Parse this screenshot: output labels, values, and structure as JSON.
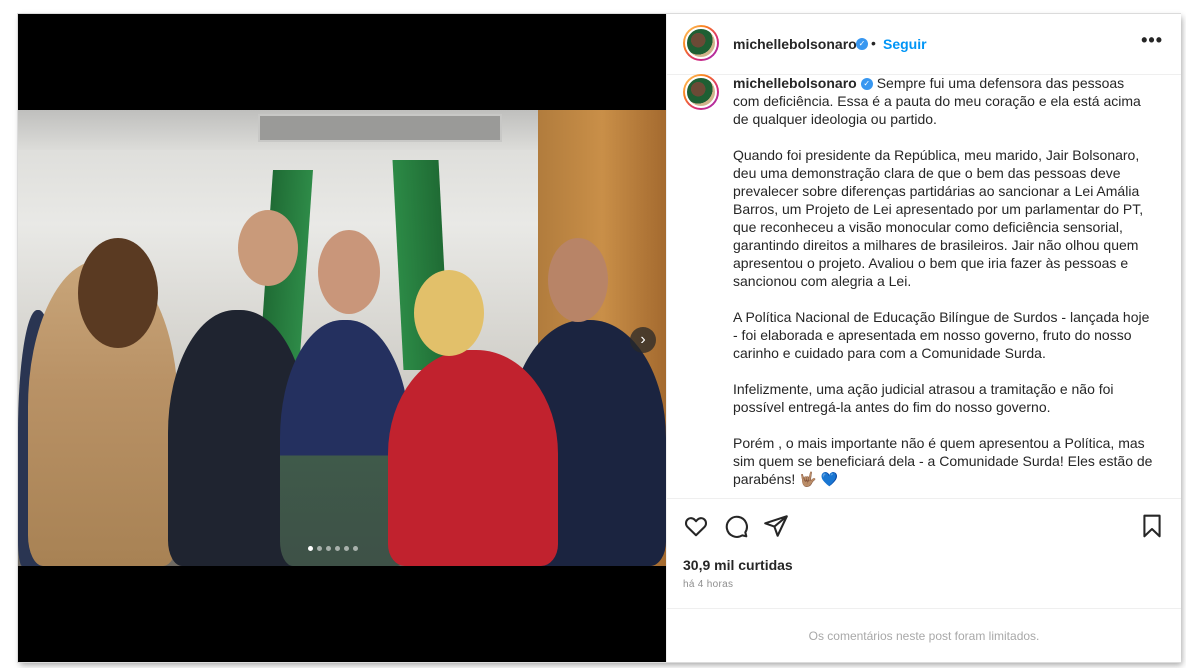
{
  "post": {
    "username": "michellebolsonaro",
    "verified_badge": "✓",
    "separator": "•",
    "follow_label": "Seguir",
    "more_label": "•••",
    "caption_intro": "Sempre fui uma defensora das pessoas com deficiência. Essa é a pauta do meu coração e ela está acima de qualquer ideologia ou partido.",
    "paragraphs": [
      "Quando foi presidente da República, meu marido, Jair Bolsonaro, deu uma demonstração clara de que o bem das pessoas deve prevalecer sobre diferenças partidárias ao sancionar a Lei Amália Barros, um Projeto de Lei apresentado por um parlamentar do PT, que reconheceu a visão monocular como deficiência sensorial, garantindo direitos a milhares de brasileiros. Jair não olhou quem apresentou o projeto. Avaliou o bem que iria fazer às pessoas e sancionou com alegria a Lei.",
      "A Política Nacional de Educação Bilíngue de Surdos - lançada hoje - foi elaborada e apresentada em nosso governo, fruto do nosso carinho e cuidado para com a Comunidade Surda.",
      "Infelizmente, uma ação judicial atrasou a tramitação e não foi possível entregá-la antes do fim do nosso governo.",
      "Porém , o mais importante não é quem apresentou a Política, mas sim quem se beneficiará dela - a Comunidade Surda! Eles estão de parabéns! 🤟🏽 💙"
    ],
    "likes": "30,9 mil curtidas",
    "timestamp": "há 4 horas",
    "comments_notice": "Os comentários neste post foram limitados.",
    "carousel": {
      "total": 6,
      "active_index": 0,
      "next_icon": "chevron-right-icon"
    }
  },
  "icons": {
    "like": "heart-icon",
    "comment": "comment-icon",
    "share": "send-icon",
    "save": "bookmark-icon"
  },
  "colors": {
    "follow": "#0095f6",
    "verified": "#3897f0",
    "text": "#262626",
    "muted": "#8e8e8e"
  }
}
